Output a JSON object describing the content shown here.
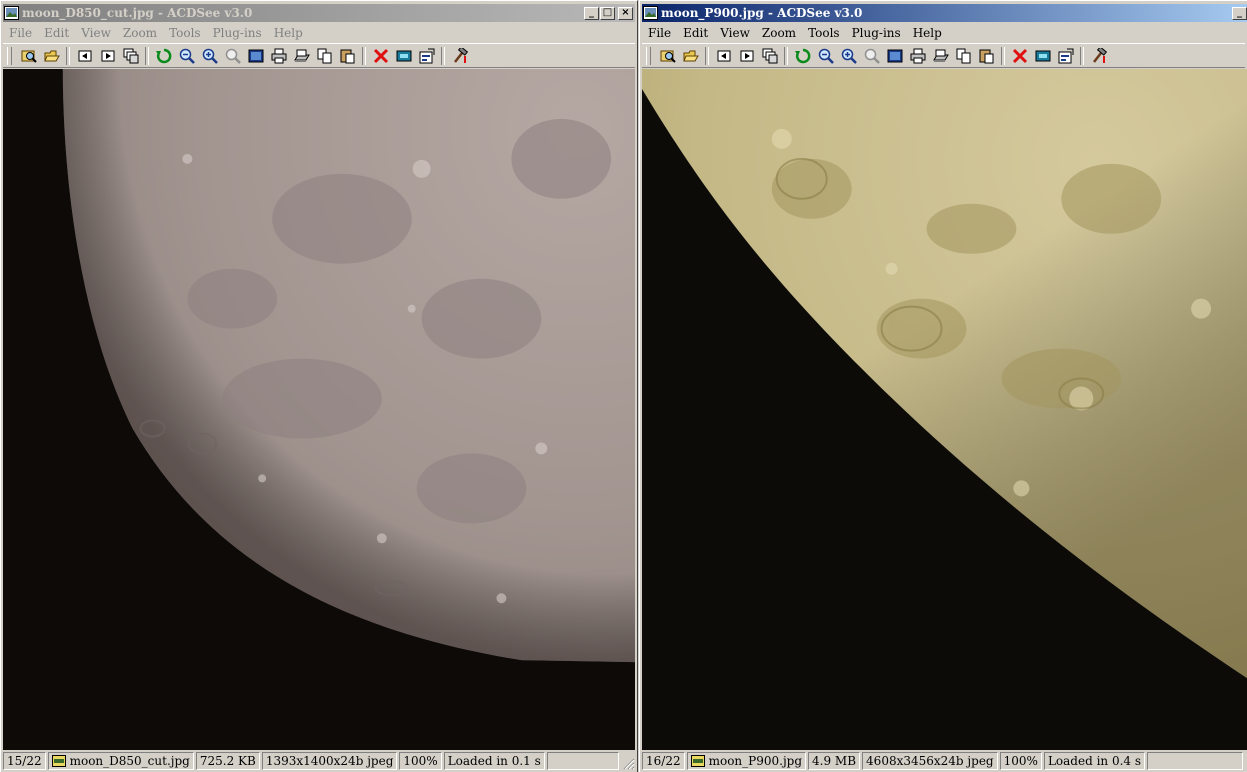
{
  "left_window": {
    "title": "moon_D850_cut.jpg - ACDSee v3.0",
    "menu": [
      "File",
      "Edit",
      "View",
      "Zoom",
      "Tools",
      "Plug-ins",
      "Help"
    ],
    "status": {
      "index": "15/22",
      "filename": "moon_D850_cut.jpg",
      "filesize": "725.2 KB",
      "dimensions": "1393x1400x24b jpeg",
      "zoom": "100%",
      "loaded": "Loaded in 0.1 s"
    },
    "image_description_colors": {
      "moon": "#a89a94",
      "sky": "#0d0a08"
    }
  },
  "right_window": {
    "title": "moon_P900.jpg - ACDSee v3.0",
    "menu": [
      "File",
      "Edit",
      "View",
      "Zoom",
      "Tools",
      "Plug-ins",
      "Help"
    ],
    "status": {
      "index": "16/22",
      "filename": "moon_P900.jpg",
      "filesize": "4.9 MB",
      "dimensions": "4608x3456x24b jpeg",
      "zoom": "100%",
      "loaded": "Loaded in 0.4 s"
    },
    "image_description_colors": {
      "moon": "#c9bd8f",
      "sky": "#0d0b07"
    }
  },
  "toolbar_icons": [
    "browse-icon",
    "open-icon",
    "previous-icon",
    "next-icon",
    "browse-window-icon",
    "refresh-icon",
    "zoom-out-icon",
    "zoom-in-icon",
    "zoom-reset-icon",
    "fullscreen-icon",
    "print-icon",
    "scan-icon",
    "copy-icon",
    "paste-icon",
    "delete-icon",
    "rename-icon",
    "properties-icon",
    "tools-icon"
  ],
  "colors": {
    "chrome": "#d4d0c8",
    "active_title": "#0a246a",
    "inactive_title": "#808080"
  }
}
